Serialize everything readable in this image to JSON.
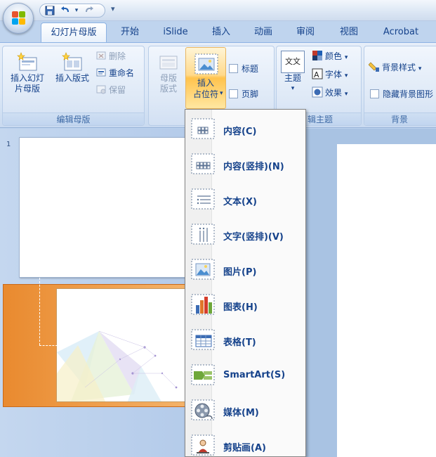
{
  "qat": {
    "undo_arrow": "▾",
    "more": "▾"
  },
  "tabs": [
    {
      "label": "幻灯片母版",
      "active": true
    },
    {
      "label": "开始"
    },
    {
      "label": "iSlide"
    },
    {
      "label": "插入"
    },
    {
      "label": "动画"
    },
    {
      "label": "审阅"
    },
    {
      "label": "视图"
    },
    {
      "label": "Acrobat"
    }
  ],
  "ribbon": {
    "edit_master": {
      "label": "编辑母版",
      "insert_master": "插入幻灯\n片母版",
      "insert_layout": "插入版式",
      "delete": "删除",
      "rename": "重命名",
      "preserve": "保留"
    },
    "master_layout": {
      "master_layout_btn": "母版\n版式",
      "insert_placeholder": "插入\n占位符",
      "title_check": "标题",
      "footer_check": "页脚"
    },
    "edit_theme": {
      "label": "编辑主题",
      "label_visible": "辑主题",
      "theme": "主题",
      "colors": "颜色",
      "fonts": "字体",
      "effects": "效果",
      "theme_icon_text": "文文"
    },
    "background": {
      "label": "背景",
      "bg_style": "背景样式",
      "hide_bg": "隐藏背景图形"
    }
  },
  "slides": {
    "slide1_number": "1"
  },
  "placeholder_menu": {
    "items": [
      {
        "label": "内容(C)",
        "icon": "content-placeholder-icon"
      },
      {
        "label": "内容(竖排)(N)",
        "icon": "content-vertical-placeholder-icon"
      },
      {
        "label": "文本(X)",
        "icon": "text-placeholder-icon"
      },
      {
        "label": "文字(竖排)(V)",
        "icon": "text-vertical-placeholder-icon"
      },
      {
        "label": "图片(P)",
        "icon": "picture-placeholder-icon"
      },
      {
        "label": "图表(H)",
        "icon": "chart-placeholder-icon"
      },
      {
        "label": "表格(T)",
        "icon": "table-placeholder-icon"
      },
      {
        "label": "SmartArt(S)",
        "icon": "smartart-placeholder-icon"
      },
      {
        "label": "媒体(M)",
        "icon": "media-placeholder-icon"
      },
      {
        "label": "剪贴画(A)",
        "icon": "clipart-placeholder-icon"
      }
    ]
  }
}
